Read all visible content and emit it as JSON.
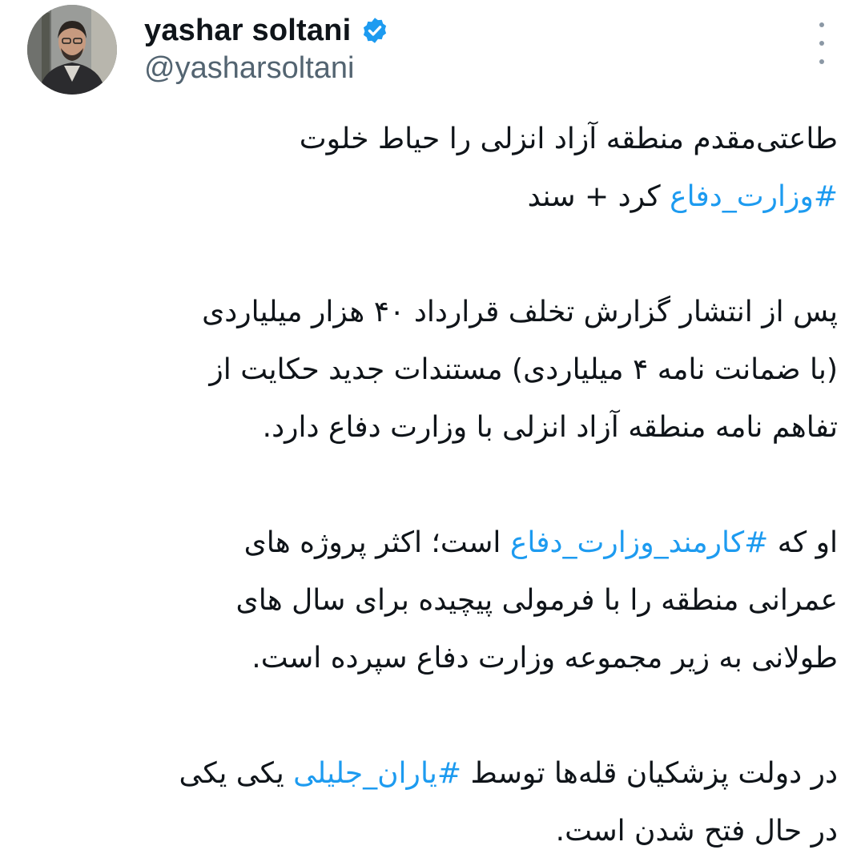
{
  "author": {
    "display_name": "yashar soltani",
    "handle": "@yasharsoltani",
    "verified": true,
    "avatar_icon": "profile-photo",
    "more_icon": "vertical-ellipsis-icon"
  },
  "tweet": {
    "p1": {
      "l1": "طاعتی‌مقدم منطقه آزاد انزلی را حیاط خلوت",
      "l2_hashtag": "#وزارت_دفاع",
      "l2_rest": " کرد + سند"
    },
    "p2": {
      "l1": "پس از انتشار گزارش تخلف قرارداد ۴۰ هزار میلیاردی",
      "l2": "(با ضمانت نامه ۴ میلیاردی) مستندات جدید حکایت از",
      "l3": "تفاهم نامه منطقه آزاد انزلی با وزارت دفاع دارد."
    },
    "p3": {
      "l1_pre": "او که ",
      "l1_hashtag": "#کارمند_وزارت_دفاع",
      "l1_post": " است؛ اکثر پروژه های",
      "l2": "عمرانی منطقه را با فرمولی پیچیده برای سال های",
      "l3": "طولانی به زیر مجموعه وزارت دفاع سپرده است."
    },
    "p4": {
      "l1_pre": "در دولت پزشکیان قله‌ها توسط ",
      "l1_hashtag": "#یاران_جلیلی",
      "l1_post": " یکی یکی",
      "l2": "در حال فتح شدن است."
    }
  },
  "colors": {
    "hashtag": "#1d9bf0",
    "verified_badge": "#1d9bf0",
    "handle": "#536471",
    "text": "#0f1419"
  }
}
